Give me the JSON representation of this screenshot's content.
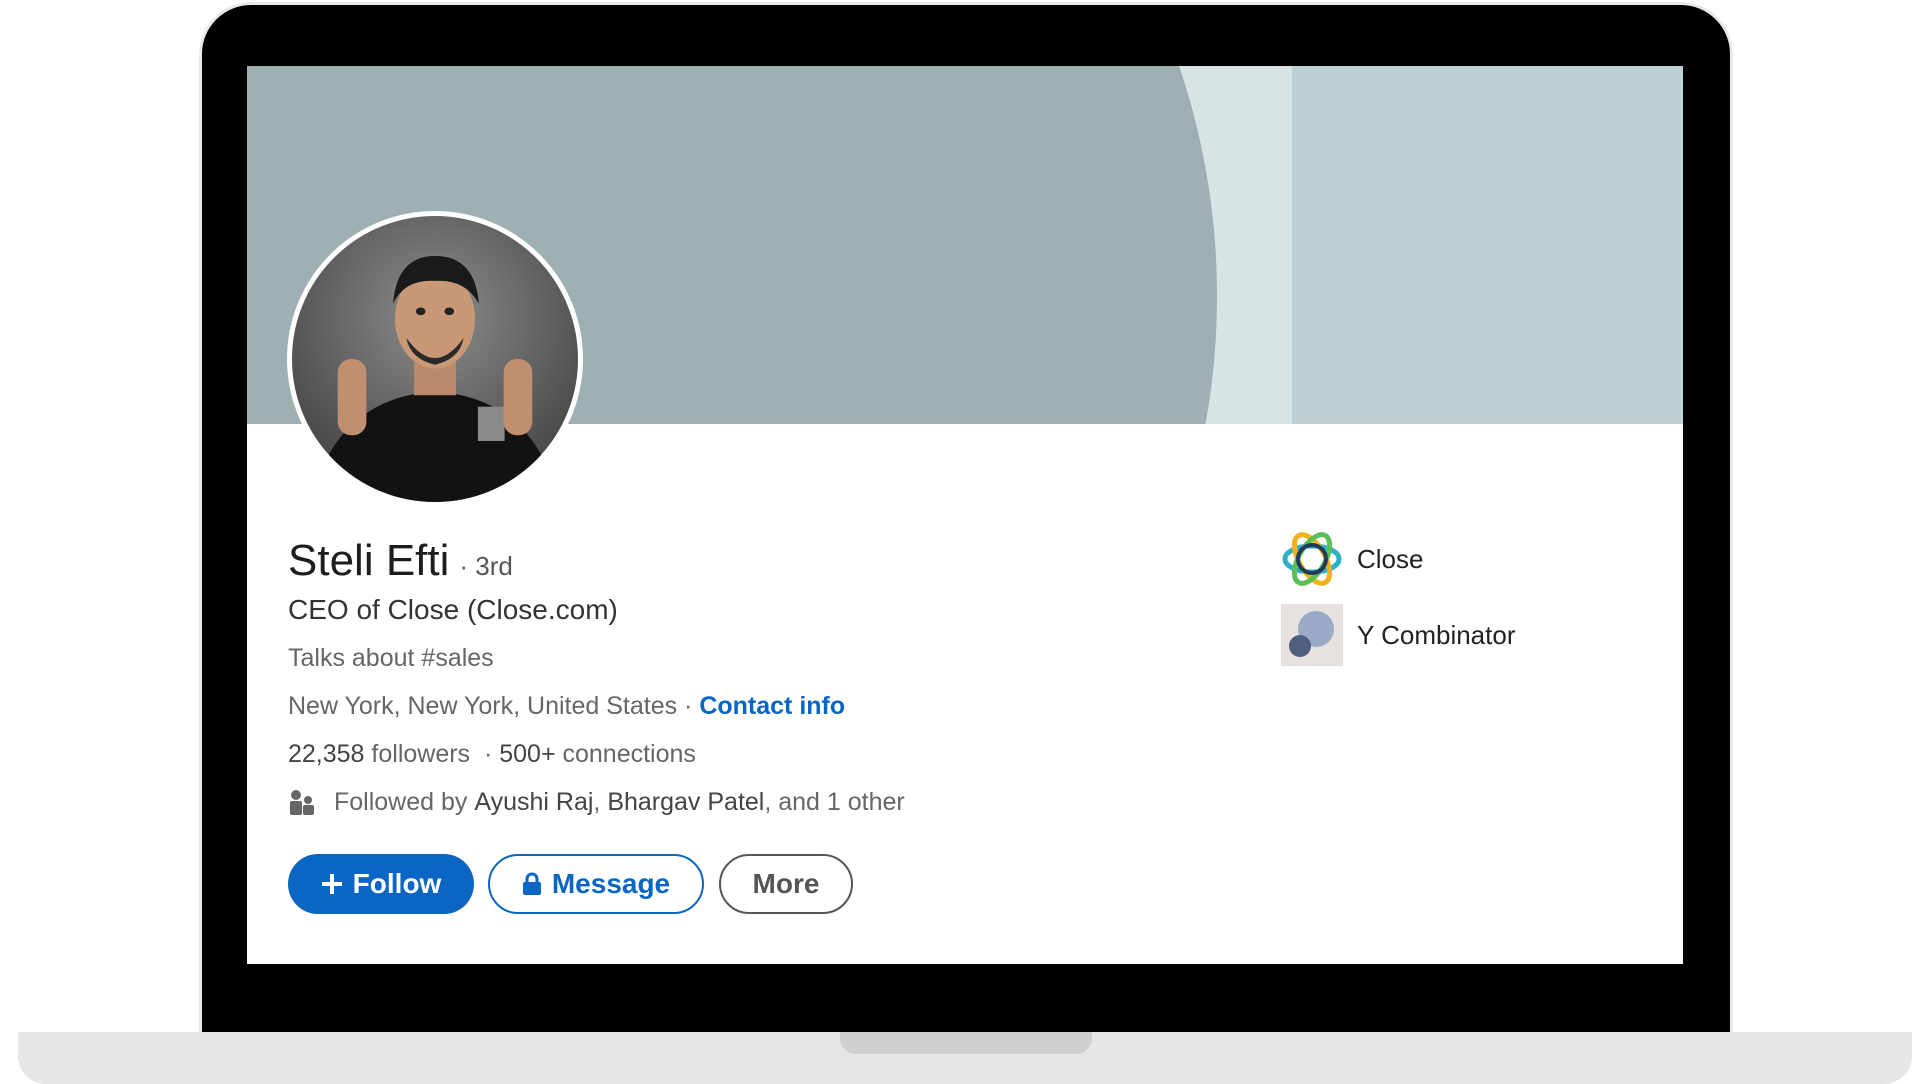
{
  "profile": {
    "name": "Steli Efti",
    "degree": "· 3rd",
    "headline": "CEO of Close (Close.com)",
    "talks_about": "Talks about #sales",
    "location": "New York, New York, United States",
    "location_sep": " · ",
    "contact_info": "Contact info",
    "followers_count": "22,358",
    "followers_label": " followers",
    "stats_sep": "  · ",
    "connections_count": "500+",
    "connections_label": " connections",
    "followed_prefix": "Followed by ",
    "followed_person1": "Ayushi Raj",
    "followed_comma": ", ",
    "followed_person2": "Bhargav Patel",
    "followed_suffix": ", and 1 other"
  },
  "actions": {
    "follow_label": "Follow",
    "message_label": "Message",
    "more_label": "More"
  },
  "companies": [
    {
      "name": "Close",
      "icon": "close-logo-icon"
    },
    {
      "name": "Y Combinator",
      "icon": "y-combinator-logo-icon"
    }
  ],
  "colors": {
    "accent": "#0a66c2",
    "cover_dark": "#9fb0b3",
    "cover_light": "#d7e3e5",
    "cover_right": "#bdd1d5"
  }
}
